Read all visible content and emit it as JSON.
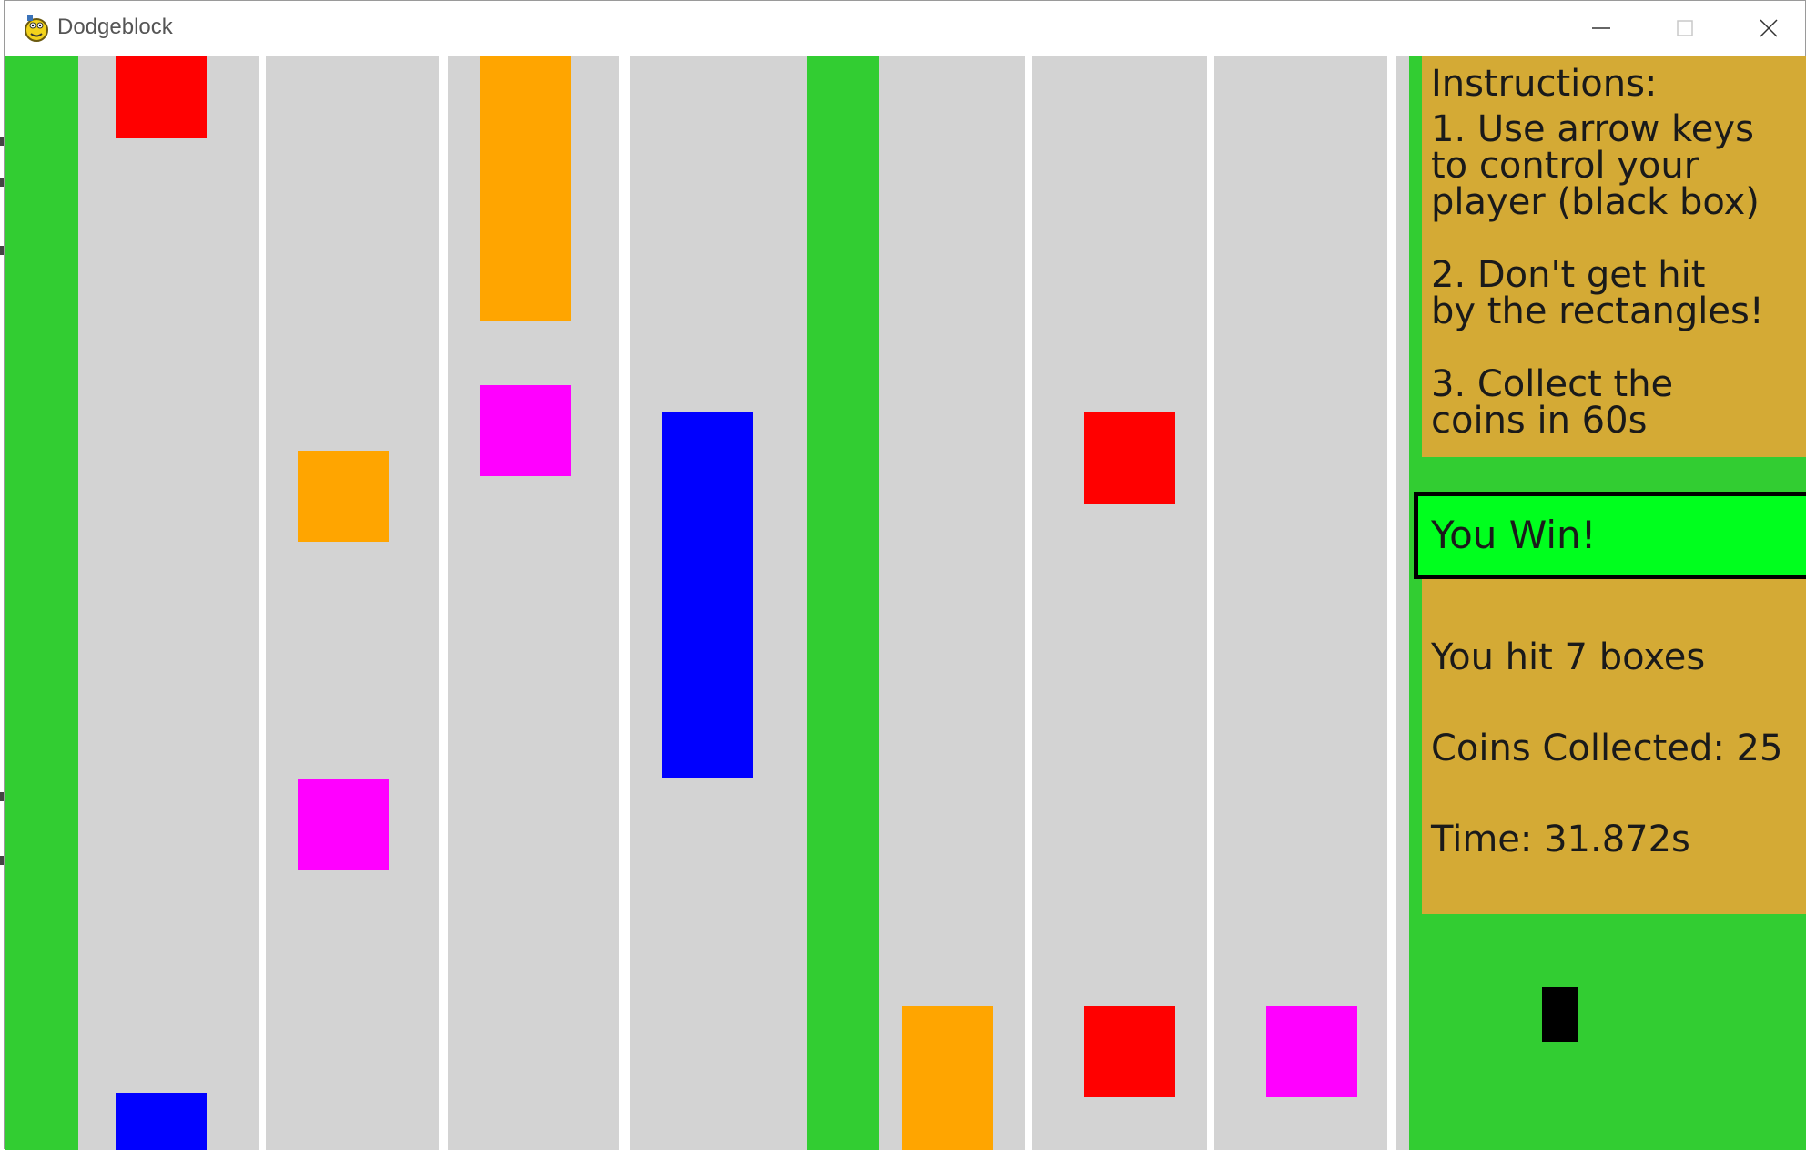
{
  "window": {
    "title": "Dodgeblock",
    "controls": {
      "minimize_icon": "minimize-icon",
      "maximize_icon": "maximize-icon",
      "close_icon": "close-icon"
    }
  },
  "colors": {
    "grass": "#32cd32",
    "road": "#d3d3d3",
    "panel": "#d4aa35",
    "win_banner": "#00ff1e",
    "player": "#000000",
    "block_red": "#ff0000",
    "block_orange": "#ffa500",
    "block_magenta": "#ff00ff",
    "block_blue": "#0000ff"
  },
  "hud": {
    "instructions": {
      "heading": "Instructions:",
      "step1_line1": "1. Use arrow keys",
      "step1_line2": "to control your",
      "step1_line3": "player (black box)",
      "step2_line1": "2. Don't get hit",
      "step2_line2": "by the rectangles!",
      "step3_line1": "3. Collect the",
      "step3_line2": "coins in 60s"
    },
    "result": "You Win!",
    "hits": "You hit 7 boxes",
    "coins": "Coins Collected: 25",
    "time": "Time: 31.872s"
  }
}
